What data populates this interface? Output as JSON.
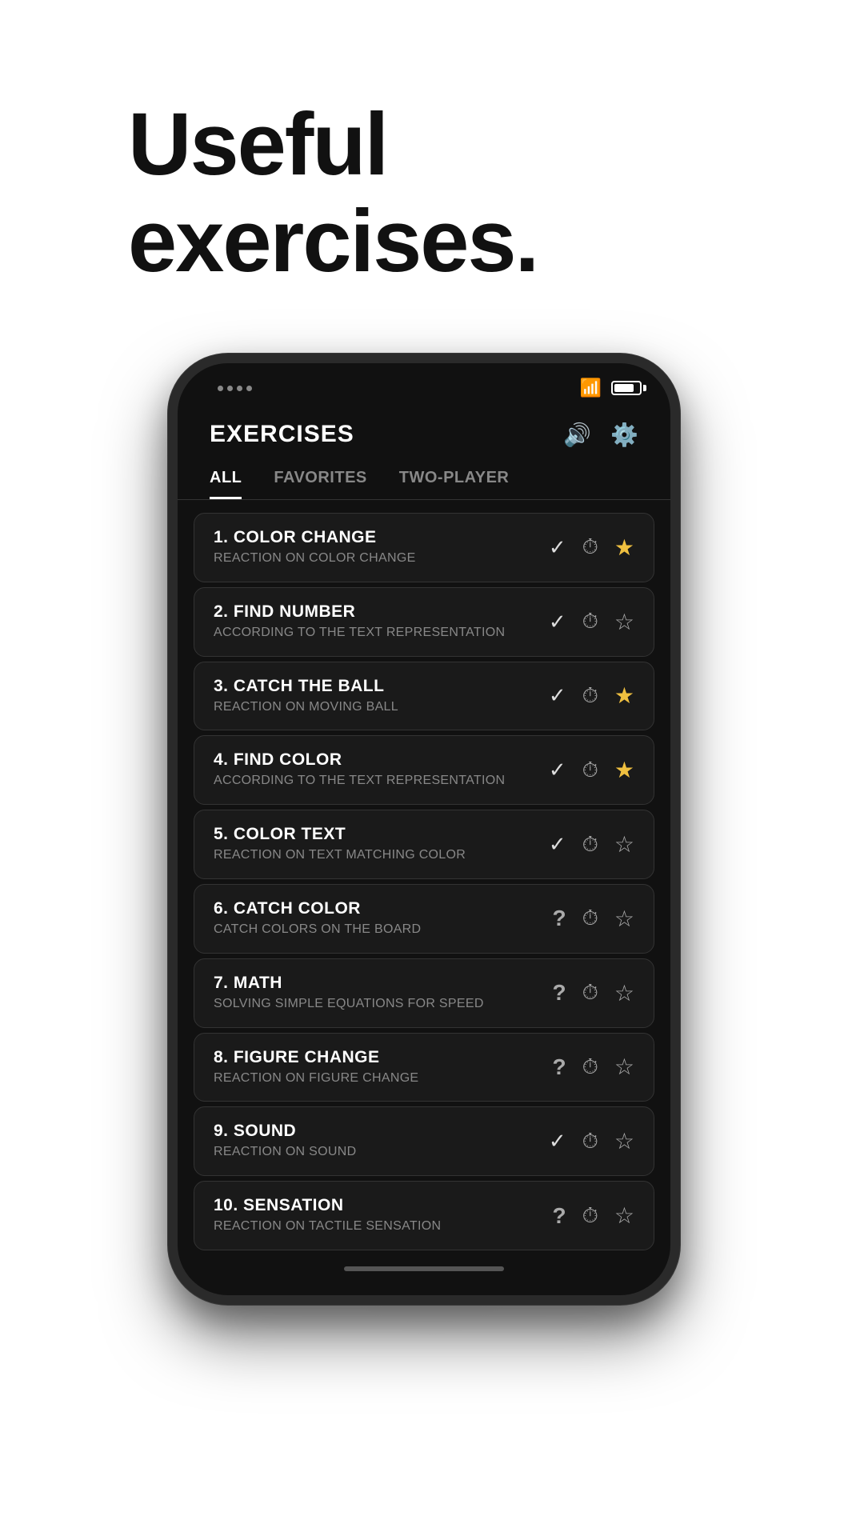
{
  "header": {
    "title": "Useful\nexercises.",
    "title_line1": "Useful",
    "title_line2": "exercises."
  },
  "app": {
    "title": "EXERCISES",
    "sound_icon": "🔈",
    "settings_icon": "⚙"
  },
  "tabs": [
    {
      "label": "ALL",
      "active": true
    },
    {
      "label": "FAVORITES",
      "active": false
    },
    {
      "label": "TWO-PLAYER",
      "active": false
    }
  ],
  "exercises": [
    {
      "number": "1.",
      "name": "COLOR CHANGE",
      "desc": "REACTION ON COLOR CHANGE",
      "status": "check",
      "favorite": true
    },
    {
      "number": "2.",
      "name": "FIND NUMBER",
      "desc": "ACCORDING TO THE TEXT REPRESENTATION",
      "status": "check",
      "favorite": false
    },
    {
      "number": "3.",
      "name": "CATCH THE BALL",
      "desc": "REACTION ON MOVING BALL",
      "status": "check",
      "favorite": true
    },
    {
      "number": "4.",
      "name": "FIND COLOR",
      "desc": "ACCORDING TO THE TEXT REPRESENTATION",
      "status": "check",
      "favorite": true
    },
    {
      "number": "5.",
      "name": "COLOR TEXT",
      "desc": "REACTION ON TEXT MATCHING COLOR",
      "status": "check",
      "favorite": false
    },
    {
      "number": "6.",
      "name": "CATCH COLOR",
      "desc": "CATCH COLORS ON THE BOARD",
      "status": "question",
      "favorite": false
    },
    {
      "number": "7.",
      "name": "MATH",
      "desc": "SOLVING SIMPLE EQUATIONS FOR SPEED",
      "status": "question",
      "favorite": false
    },
    {
      "number": "8.",
      "name": "FIGURE CHANGE",
      "desc": "REACTION ON FIGURE CHANGE",
      "status": "question",
      "favorite": false
    },
    {
      "number": "9.",
      "name": "SOUND",
      "desc": "REACTION ON SOUND",
      "status": "check",
      "favorite": false
    },
    {
      "number": "10.",
      "name": "SENSATION",
      "desc": "REACTION ON TACTILE SENSATION",
      "status": "question",
      "favorite": false
    }
  ]
}
